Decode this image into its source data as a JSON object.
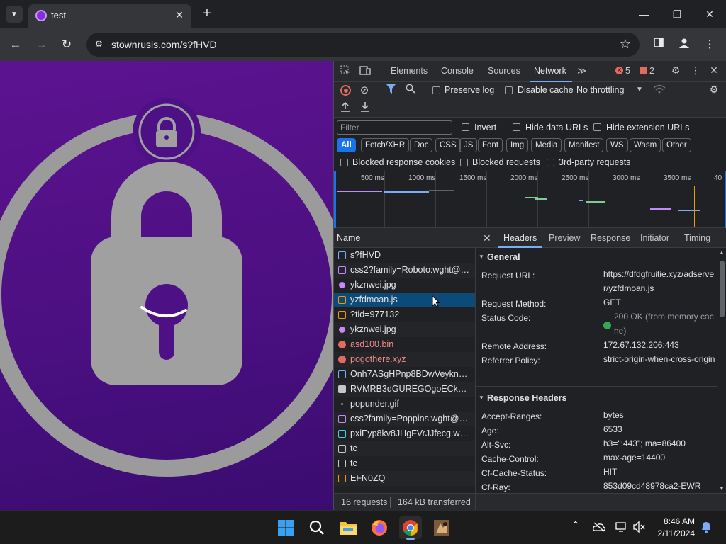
{
  "tab": {
    "title": "test",
    "close": "✕",
    "new_tab": "+"
  },
  "window": {
    "minimize": "—",
    "maximize": "❐",
    "close": "✕"
  },
  "toolbar": {
    "back": "←",
    "forward": "→",
    "reload": "↻",
    "url": "stownrusis.com/s?fHVD",
    "star": "☆",
    "menu": "⋮"
  },
  "devtools": {
    "tabs": [
      "Elements",
      "Console",
      "Sources",
      "Network"
    ],
    "more_tabs": "≫",
    "errors": "5",
    "warnings": "2",
    "preserve_log": "Preserve log",
    "disable_cache": "Disable cache",
    "throttling": "No throttling",
    "filter_placeholder": "Filter",
    "invert": "Invert",
    "hide_data_urls": "Hide data URLs",
    "hide_extension_urls": "Hide extension URLs",
    "type_filters": [
      "All",
      "Fetch/XHR",
      "Doc",
      "CSS",
      "JS",
      "Font",
      "Img",
      "Media",
      "Manifest",
      "WS",
      "Wasm",
      "Other"
    ],
    "blocked_cookies": "Blocked response cookies",
    "blocked_requests": "Blocked requests",
    "third_party": "3rd-party requests",
    "timeline_ticks": [
      "500 ms",
      "1000 ms",
      "1500 ms",
      "2000 ms",
      "2500 ms",
      "3000 ms",
      "3500 ms",
      "40"
    ],
    "name_header": "Name",
    "requests": [
      {
        "name": "s?fHVD",
        "type": "doc",
        "error": false
      },
      {
        "name": "css2?family=Roboto:wght@10...",
        "type": "css",
        "error": false
      },
      {
        "name": "ykznwei.jpg",
        "type": "img",
        "error": false
      },
      {
        "name": "yzfdmoan.js",
        "type": "js",
        "error": false
      },
      {
        "name": "?tid=977132",
        "type": "js",
        "error": false
      },
      {
        "name": "ykznwei.jpg",
        "type": "img",
        "error": false
      },
      {
        "name": "asd100.bin",
        "type": "err",
        "error": true
      },
      {
        "name": "pogothere.xyz",
        "type": "err",
        "error": true
      },
      {
        "name": "Onh7ASgHPnp8BDwVeyknGg...",
        "type": "doc",
        "error": false
      },
      {
        "name": "RVMRB3dGUREGOgoECkNsGx...",
        "type": "doc2",
        "error": false
      },
      {
        "name": "popunder.gif",
        "type": "dot",
        "error": false
      },
      {
        "name": "css?family=Poppins:wght@30...",
        "type": "css",
        "error": false
      },
      {
        "name": "pxiEyp8kv8JHgFVrJJfecg.woff2",
        "type": "font",
        "error": false
      },
      {
        "name": "tc",
        "type": "file",
        "error": false
      },
      {
        "name": "tc",
        "type": "box",
        "error": false
      },
      {
        "name": "EFN0ZQ",
        "type": "js",
        "error": false
      }
    ],
    "selected_index": 3,
    "status_requests": "16 requests",
    "status_transferred": "164 kB transferred",
    "detail_tabs": [
      "Headers",
      "Preview",
      "Response",
      "Initiator",
      "Timing"
    ],
    "general_title": "General",
    "general": [
      {
        "key": "Request URL:",
        "value": "https://dfdgfruitie.xyz/adserver/yzfdmoan.js"
      },
      {
        "key": "Request Method:",
        "value": "GET"
      },
      {
        "key": "Status Code:",
        "value": "200 OK (from memory cache)"
      },
      {
        "key": "Remote Address:",
        "value": "172.67.132.206:443"
      },
      {
        "key": "Referrer Policy:",
        "value": "strict-origin-when-cross-origin"
      }
    ],
    "response_title": "Response Headers",
    "response": [
      {
        "key": "Accept-Ranges:",
        "value": "bytes"
      },
      {
        "key": "Age:",
        "value": "6533"
      },
      {
        "key": "Alt-Svc:",
        "value": "h3=\":443\"; ma=86400"
      },
      {
        "key": "Cache-Control:",
        "value": "max-age=14400"
      },
      {
        "key": "Cf-Cache-Status:",
        "value": "HIT"
      },
      {
        "key": "Cf-Ray:",
        "value": "853d09cd48978ca2-EWR"
      }
    ]
  },
  "taskbar": {
    "time": "8:46 AM",
    "date": "2/11/2024"
  },
  "colors": {
    "accent": "#7cacf8",
    "page_bg": "#4a0f80",
    "selected_row": "#0b4a79",
    "error_text": "#f28b82"
  }
}
